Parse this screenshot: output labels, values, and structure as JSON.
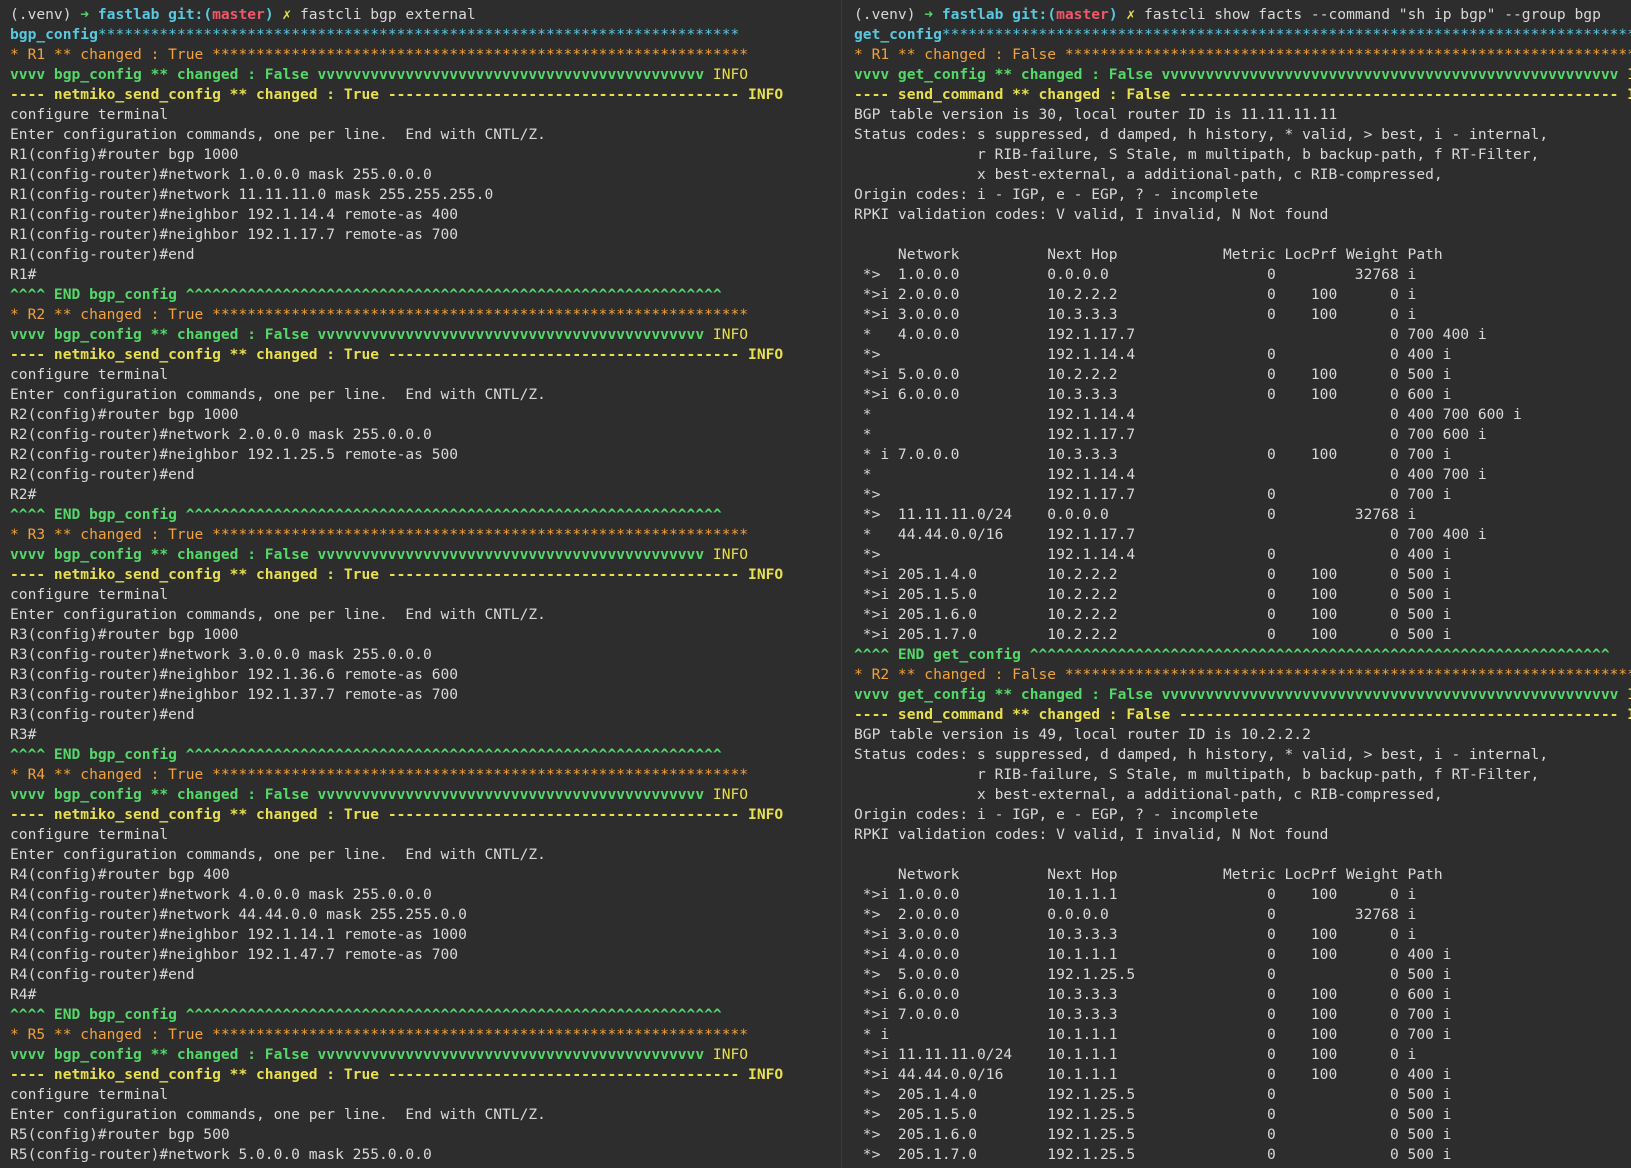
{
  "terminal_left": {
    "lines": [
      [
        {
          "t": "(.venv) ",
          "c": "default"
        },
        {
          "t": "➜ ",
          "c": "green-bold"
        },
        {
          "t": "fastlab ",
          "c": "cyan-bold"
        },
        {
          "t": "git:(",
          "c": "cyan-bold"
        },
        {
          "t": "master",
          "c": "red-bold"
        },
        {
          "t": ") ",
          "c": "cyan-bold"
        },
        {
          "t": "✗ ",
          "c": "yellow-bold"
        },
        {
          "t": "fastcli bgp external",
          "c": "default"
        }
      ],
      [
        {
          "t": "bgp_config",
          "c": "cyan-bold"
        },
        {
          "t": "*************************************************************************",
          "c": "cyan"
        }
      ],
      [
        {
          "t": "* R1 ** changed : True ",
          "c": "orange"
        },
        {
          "t": "*************************************************************",
          "c": "orange"
        }
      ],
      [
        {
          "t": "vvvv bgp_config ** changed : False vvvvvvvvvvvvvvvvvvvvvvvvvvvvvvvvvvvvvvvvvvvv ",
          "c": "green-bold"
        },
        {
          "t": "INFO",
          "c": "yellow"
        }
      ],
      [
        {
          "t": "---- netmiko_send_config ** changed : True ",
          "c": "yellow-bold"
        },
        {
          "t": "---------------------------------------- INFO",
          "c": "yellow-bold"
        }
      ],
      [
        {
          "t": "configure terminal",
          "c": "default"
        }
      ],
      [
        {
          "t": "Enter configuration commands, one per line.  End with CNTL/Z.",
          "c": "default"
        }
      ],
      [
        {
          "t": "R1(config)#router bgp 1000",
          "c": "default"
        }
      ],
      [
        {
          "t": "R1(config-router)#network 1.0.0.0 mask 255.0.0.0",
          "c": "default"
        }
      ],
      [
        {
          "t": "R1(config-router)#network 11.11.11.0 mask 255.255.255.0",
          "c": "default"
        }
      ],
      [
        {
          "t": "R1(config-router)#neighbor 192.1.14.4 remote-as 400",
          "c": "default"
        }
      ],
      [
        {
          "t": "R1(config-router)#neighbor 192.1.17.7 remote-as 700",
          "c": "default"
        }
      ],
      [
        {
          "t": "R1(config-router)#end",
          "c": "default"
        }
      ],
      [
        {
          "t": "R1#",
          "c": "default"
        }
      ],
      [
        {
          "t": "^^^^ END bgp_config ^^^^^^^^^^^^^^^^^^^^^^^^^^^^^^^^^^^^^^^^^^^^^^^^^^^^^^^^^^^^^",
          "c": "green-bold"
        }
      ],
      [
        {
          "t": "* R2 ** changed : True ",
          "c": "orange"
        },
        {
          "t": "*************************************************************",
          "c": "orange"
        }
      ],
      [
        {
          "t": "vvvv bgp_config ** changed : False vvvvvvvvvvvvvvvvvvvvvvvvvvvvvvvvvvvvvvvvvvvv ",
          "c": "green-bold"
        },
        {
          "t": "INFO",
          "c": "yellow"
        }
      ],
      [
        {
          "t": "---- netmiko_send_config ** changed : True ",
          "c": "yellow-bold"
        },
        {
          "t": "---------------------------------------- INFO",
          "c": "yellow-bold"
        }
      ],
      [
        {
          "t": "configure terminal",
          "c": "default"
        }
      ],
      [
        {
          "t": "Enter configuration commands, one per line.  End with CNTL/Z.",
          "c": "default"
        }
      ],
      [
        {
          "t": "R2(config)#router bgp 1000",
          "c": "default"
        }
      ],
      [
        {
          "t": "R2(config-router)#network 2.0.0.0 mask 255.0.0.0",
          "c": "default"
        }
      ],
      [
        {
          "t": "R2(config-router)#neighbor 192.1.25.5 remote-as 500",
          "c": "default"
        }
      ],
      [
        {
          "t": "R2(config-router)#end",
          "c": "default"
        }
      ],
      [
        {
          "t": "R2#",
          "c": "default"
        }
      ],
      [
        {
          "t": "^^^^ END bgp_config ^^^^^^^^^^^^^^^^^^^^^^^^^^^^^^^^^^^^^^^^^^^^^^^^^^^^^^^^^^^^^",
          "c": "green-bold"
        }
      ],
      [
        {
          "t": "* R3 ** changed : True ",
          "c": "orange"
        },
        {
          "t": "*************************************************************",
          "c": "orange"
        }
      ],
      [
        {
          "t": "vvvv bgp_config ** changed : False vvvvvvvvvvvvvvvvvvvvvvvvvvvvvvvvvvvvvvvvvvvv ",
          "c": "green-bold"
        },
        {
          "t": "INFO",
          "c": "yellow"
        }
      ],
      [
        {
          "t": "---- netmiko_send_config ** changed : True ",
          "c": "yellow-bold"
        },
        {
          "t": "---------------------------------------- INFO",
          "c": "yellow-bold"
        }
      ],
      [
        {
          "t": "configure terminal",
          "c": "default"
        }
      ],
      [
        {
          "t": "Enter configuration commands, one per line.  End with CNTL/Z.",
          "c": "default"
        }
      ],
      [
        {
          "t": "R3(config)#router bgp 1000",
          "c": "default"
        }
      ],
      [
        {
          "t": "R3(config-router)#network 3.0.0.0 mask 255.0.0.0",
          "c": "default"
        }
      ],
      [
        {
          "t": "R3(config-router)#neighbor 192.1.36.6 remote-as 600",
          "c": "default"
        }
      ],
      [
        {
          "t": "R3(config-router)#neighbor 192.1.37.7 remote-as 700",
          "c": "default"
        }
      ],
      [
        {
          "t": "R3(config-router)#end",
          "c": "default"
        }
      ],
      [
        {
          "t": "R3#",
          "c": "default"
        }
      ],
      [
        {
          "t": "^^^^ END bgp_config ^^^^^^^^^^^^^^^^^^^^^^^^^^^^^^^^^^^^^^^^^^^^^^^^^^^^^^^^^^^^^",
          "c": "green-bold"
        }
      ],
      [
        {
          "t": "* R4 ** changed : True ",
          "c": "orange"
        },
        {
          "t": "*************************************************************",
          "c": "orange"
        }
      ],
      [
        {
          "t": "vvvv bgp_config ** changed : False vvvvvvvvvvvvvvvvvvvvvvvvvvvvvvvvvvvvvvvvvvvv ",
          "c": "green-bold"
        },
        {
          "t": "INFO",
          "c": "yellow"
        }
      ],
      [
        {
          "t": "---- netmiko_send_config ** changed : True ",
          "c": "yellow-bold"
        },
        {
          "t": "---------------------------------------- INFO",
          "c": "yellow-bold"
        }
      ],
      [
        {
          "t": "configure terminal",
          "c": "default"
        }
      ],
      [
        {
          "t": "Enter configuration commands, one per line.  End with CNTL/Z.",
          "c": "default"
        }
      ],
      [
        {
          "t": "R4(config)#router bgp 400",
          "c": "default"
        }
      ],
      [
        {
          "t": "R4(config-router)#network 4.0.0.0 mask 255.0.0.0",
          "c": "default"
        }
      ],
      [
        {
          "t": "R4(config-router)#network 44.44.0.0 mask 255.255.0.0",
          "c": "default"
        }
      ],
      [
        {
          "t": "R4(config-router)#neighbor 192.1.14.1 remote-as 1000",
          "c": "default"
        }
      ],
      [
        {
          "t": "R4(config-router)#neighbor 192.1.47.7 remote-as 700",
          "c": "default"
        }
      ],
      [
        {
          "t": "R4(config-router)#end",
          "c": "default"
        }
      ],
      [
        {
          "t": "R4#",
          "c": "default"
        }
      ],
      [
        {
          "t": "^^^^ END bgp_config ^^^^^^^^^^^^^^^^^^^^^^^^^^^^^^^^^^^^^^^^^^^^^^^^^^^^^^^^^^^^^",
          "c": "green-bold"
        }
      ],
      [
        {
          "t": "* R5 ** changed : True ",
          "c": "orange"
        },
        {
          "t": "*************************************************************",
          "c": "orange"
        }
      ],
      [
        {
          "t": "vvvv bgp_config ** changed : False vvvvvvvvvvvvvvvvvvvvvvvvvvvvvvvvvvvvvvvvvvvv ",
          "c": "green-bold"
        },
        {
          "t": "INFO",
          "c": "yellow"
        }
      ],
      [
        {
          "t": "---- netmiko_send_config ** changed : True ",
          "c": "yellow-bold"
        },
        {
          "t": "---------------------------------------- INFO",
          "c": "yellow-bold"
        }
      ],
      [
        {
          "t": "configure terminal",
          "c": "default"
        }
      ],
      [
        {
          "t": "Enter configuration commands, one per line.  End with CNTL/Z.",
          "c": "default"
        }
      ],
      [
        {
          "t": "R5(config)#router bgp 500",
          "c": "default"
        }
      ],
      [
        {
          "t": "R5(config-router)#network 5.0.0.0 mask 255.0.0.0",
          "c": "default"
        }
      ]
    ]
  },
  "terminal_right": {
    "lines": [
      [
        {
          "t": "(.venv) ",
          "c": "default"
        },
        {
          "t": "➜ ",
          "c": "green-bold"
        },
        {
          "t": "fastlab ",
          "c": "cyan-bold"
        },
        {
          "t": "git:(",
          "c": "cyan-bold"
        },
        {
          "t": "master",
          "c": "red-bold"
        },
        {
          "t": ") ",
          "c": "cyan-bold"
        },
        {
          "t": "✗ ",
          "c": "yellow-bold"
        },
        {
          "t": "fastcli show facts --command \"sh ip bgp\" --group bgp",
          "c": "default"
        }
      ],
      [
        {
          "t": "get_config",
          "c": "cyan-bold"
        },
        {
          "t": "***********************************************************************************",
          "c": "cyan"
        }
      ],
      [
        {
          "t": "* R1 ** changed : False ",
          "c": "orange"
        },
        {
          "t": "******************************************************************",
          "c": "orange"
        }
      ],
      [
        {
          "t": "vvvv get_config ** changed : False vvvvvvvvvvvvvvvvvvvvvvvvvvvvvvvvvvvvvvvvvvvvvvvvvvvv ",
          "c": "green-bold"
        },
        {
          "t": "INFO",
          "c": "yellow"
        }
      ],
      [
        {
          "t": "---- send_command ** changed : False ",
          "c": "yellow-bold"
        },
        {
          "t": "-------------------------------------------------- INFO",
          "c": "yellow-bold"
        }
      ],
      [
        {
          "t": "BGP table version is 30, local router ID is 11.11.11.11",
          "c": "default"
        }
      ],
      [
        {
          "t": "Status codes: s suppressed, d damped, h history, * valid, > best, i - internal,",
          "c": "default"
        }
      ],
      [
        {
          "t": "              r RIB-failure, S Stale, m multipath, b backup-path, f RT-Filter,",
          "c": "default"
        }
      ],
      [
        {
          "t": "              x best-external, a additional-path, c RIB-compressed,",
          "c": "default"
        }
      ],
      [
        {
          "t": "Origin codes: i - IGP, e - EGP, ? - incomplete",
          "c": "default"
        }
      ],
      [
        {
          "t": "RPKI validation codes: V valid, I invalid, N Not found",
          "c": "default"
        }
      ],
      [
        {
          "t": "",
          "c": "default"
        }
      ],
      [
        {
          "t": "     Network          Next Hop            Metric LocPrf Weight Path",
          "c": "default"
        }
      ],
      [
        {
          "t": " *>  1.0.0.0          0.0.0.0                  0         32768 i",
          "c": "default"
        }
      ],
      [
        {
          "t": " *>i 2.0.0.0          10.2.2.2                 0    100      0 i",
          "c": "default"
        }
      ],
      [
        {
          "t": " *>i 3.0.0.0          10.3.3.3                 0    100      0 i",
          "c": "default"
        }
      ],
      [
        {
          "t": " *   4.0.0.0          192.1.17.7                             0 700 400 i",
          "c": "default"
        }
      ],
      [
        {
          "t": " *>                   192.1.14.4               0             0 400 i",
          "c": "default"
        }
      ],
      [
        {
          "t": " *>i 5.0.0.0          10.2.2.2                 0    100      0 500 i",
          "c": "default"
        }
      ],
      [
        {
          "t": " *>i 6.0.0.0          10.3.3.3                 0    100      0 600 i",
          "c": "default"
        }
      ],
      [
        {
          "t": " *                    192.1.14.4                             0 400 700 600 i",
          "c": "default"
        }
      ],
      [
        {
          "t": " *                    192.1.17.7                             0 700 600 i",
          "c": "default"
        }
      ],
      [
        {
          "t": " * i 7.0.0.0          10.3.3.3                 0    100      0 700 i",
          "c": "default"
        }
      ],
      [
        {
          "t": " *                    192.1.14.4                             0 400 700 i",
          "c": "default"
        }
      ],
      [
        {
          "t": " *>                   192.1.17.7               0             0 700 i",
          "c": "default"
        }
      ],
      [
        {
          "t": " *>  11.11.11.0/24    0.0.0.0                  0         32768 i",
          "c": "default"
        }
      ],
      [
        {
          "t": " *   44.44.0.0/16     192.1.17.7                             0 700 400 i",
          "c": "default"
        }
      ],
      [
        {
          "t": " *>                   192.1.14.4               0             0 400 i",
          "c": "default"
        }
      ],
      [
        {
          "t": " *>i 205.1.4.0        10.2.2.2                 0    100      0 500 i",
          "c": "default"
        }
      ],
      [
        {
          "t": " *>i 205.1.5.0        10.2.2.2                 0    100      0 500 i",
          "c": "default"
        }
      ],
      [
        {
          "t": " *>i 205.1.6.0        10.2.2.2                 0    100      0 500 i",
          "c": "default"
        }
      ],
      [
        {
          "t": " *>i 205.1.7.0        10.2.2.2                 0    100      0 500 i",
          "c": "default"
        }
      ],
      [
        {
          "t": "^^^^ END get_config ^^^^^^^^^^^^^^^^^^^^^^^^^^^^^^^^^^^^^^^^^^^^^^^^^^^^^^^^^^^^^^^^^^",
          "c": "green-bold"
        }
      ],
      [
        {
          "t": "* R2 ** changed : False ",
          "c": "orange"
        },
        {
          "t": "******************************************************************",
          "c": "orange"
        }
      ],
      [
        {
          "t": "vvvv get_config ** changed : False vvvvvvvvvvvvvvvvvvvvvvvvvvvvvvvvvvvvvvvvvvvvvvvvvvvv ",
          "c": "green-bold"
        },
        {
          "t": "INFO",
          "c": "yellow"
        }
      ],
      [
        {
          "t": "---- send_command ** changed : False ",
          "c": "yellow-bold"
        },
        {
          "t": "-------------------------------------------------- INFO",
          "c": "yellow-bold"
        }
      ],
      [
        {
          "t": "BGP table version is 49, local router ID is 10.2.2.2",
          "c": "default"
        }
      ],
      [
        {
          "t": "Status codes: s suppressed, d damped, h history, * valid, > best, i - internal,",
          "c": "default"
        }
      ],
      [
        {
          "t": "              r RIB-failure, S Stale, m multipath, b backup-path, f RT-Filter,",
          "c": "default"
        }
      ],
      [
        {
          "t": "              x best-external, a additional-path, c RIB-compressed,",
          "c": "default"
        }
      ],
      [
        {
          "t": "Origin codes: i - IGP, e - EGP, ? - incomplete",
          "c": "default"
        }
      ],
      [
        {
          "t": "RPKI validation codes: V valid, I invalid, N Not found",
          "c": "default"
        }
      ],
      [
        {
          "t": "",
          "c": "default"
        }
      ],
      [
        {
          "t": "     Network          Next Hop            Metric LocPrf Weight Path",
          "c": "default"
        }
      ],
      [
        {
          "t": " *>i 1.0.0.0          10.1.1.1                 0    100      0 i",
          "c": "default"
        }
      ],
      [
        {
          "t": " *>  2.0.0.0          0.0.0.0                  0         32768 i",
          "c": "default"
        }
      ],
      [
        {
          "t": " *>i 3.0.0.0          10.3.3.3                 0    100      0 i",
          "c": "default"
        }
      ],
      [
        {
          "t": " *>i 4.0.0.0          10.1.1.1                 0    100      0 400 i",
          "c": "default"
        }
      ],
      [
        {
          "t": " *>  5.0.0.0          192.1.25.5               0             0 500 i",
          "c": "default"
        }
      ],
      [
        {
          "t": " *>i 6.0.0.0          10.3.3.3                 0    100      0 600 i",
          "c": "default"
        }
      ],
      [
        {
          "t": " *>i 7.0.0.0          10.3.3.3                 0    100      0 700 i",
          "c": "default"
        }
      ],
      [
        {
          "t": " * i                  10.1.1.1                 0    100      0 700 i",
          "c": "default"
        }
      ],
      [
        {
          "t": " *>i 11.11.11.0/24    10.1.1.1                 0    100      0 i",
          "c": "default"
        }
      ],
      [
        {
          "t": " *>i 44.44.0.0/16     10.1.1.1                 0    100      0 400 i",
          "c": "default"
        }
      ],
      [
        {
          "t": " *>  205.1.4.0        192.1.25.5               0             0 500 i",
          "c": "default"
        }
      ],
      [
        {
          "t": " *>  205.1.5.0        192.1.25.5               0             0 500 i",
          "c": "default"
        }
      ],
      [
        {
          "t": " *>  205.1.6.0        192.1.25.5               0             0 500 i",
          "c": "default"
        }
      ],
      [
        {
          "t": " *>  205.1.7.0        192.1.25.5               0             0 500 i",
          "c": "default"
        }
      ]
    ]
  }
}
